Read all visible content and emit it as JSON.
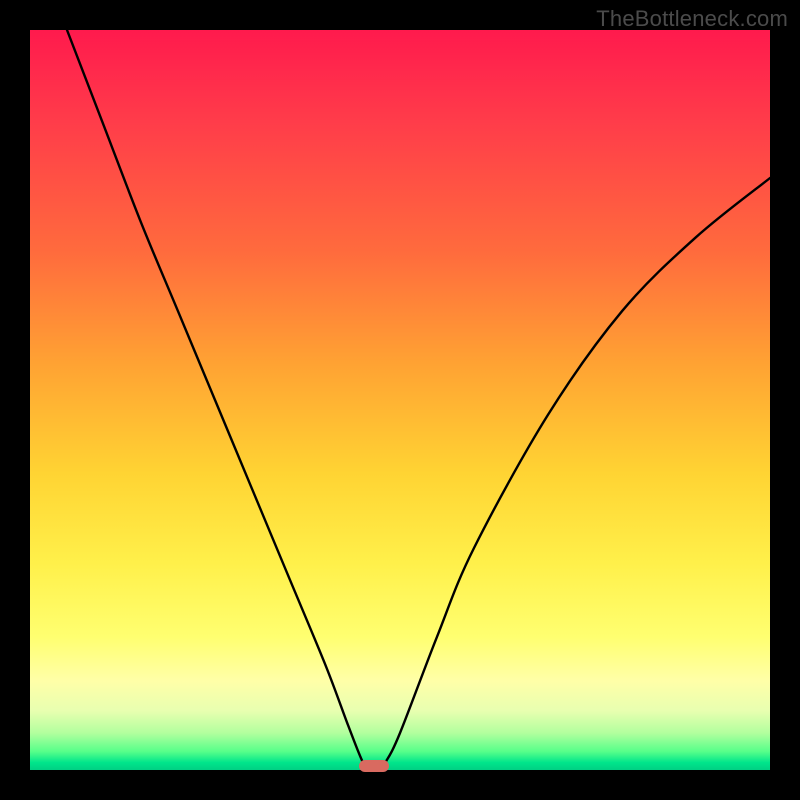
{
  "watermark": "TheBottleneck.com",
  "colors": {
    "frame": "#000000",
    "curve": "#000000",
    "marker": "#d96a60",
    "gradient_top": "#ff1a4d",
    "gradient_mid": "#fff04a",
    "gradient_bottom": "#00d084"
  },
  "chart_data": {
    "type": "line",
    "title": "",
    "xlabel": "",
    "ylabel": "",
    "xlim": [
      0,
      100
    ],
    "ylim": [
      0,
      100
    ],
    "grid": false,
    "legend": false,
    "annotations": [
      {
        "text": "TheBottleneck.com",
        "position": "top-right"
      }
    ],
    "curve_description": "V-shaped bottleneck curve with minimum at optimum point",
    "optimum_x": 46,
    "optimum_y": 0,
    "curve_points": [
      {
        "x": 5,
        "y": 100
      },
      {
        "x": 10,
        "y": 87
      },
      {
        "x": 15,
        "y": 74
      },
      {
        "x": 20,
        "y": 62
      },
      {
        "x": 25,
        "y": 50
      },
      {
        "x": 30,
        "y": 38
      },
      {
        "x": 35,
        "y": 26
      },
      {
        "x": 40,
        "y": 14
      },
      {
        "x": 43,
        "y": 6
      },
      {
        "x": 45,
        "y": 1
      },
      {
        "x": 46,
        "y": 0
      },
      {
        "x": 47,
        "y": 0
      },
      {
        "x": 48,
        "y": 1
      },
      {
        "x": 50,
        "y": 5
      },
      {
        "x": 55,
        "y": 18
      },
      {
        "x": 60,
        "y": 30
      },
      {
        "x": 70,
        "y": 48
      },
      {
        "x": 80,
        "y": 62
      },
      {
        "x": 90,
        "y": 72
      },
      {
        "x": 100,
        "y": 80
      }
    ],
    "marker": {
      "x": 46.5,
      "y": 0,
      "shape": "pill"
    }
  }
}
